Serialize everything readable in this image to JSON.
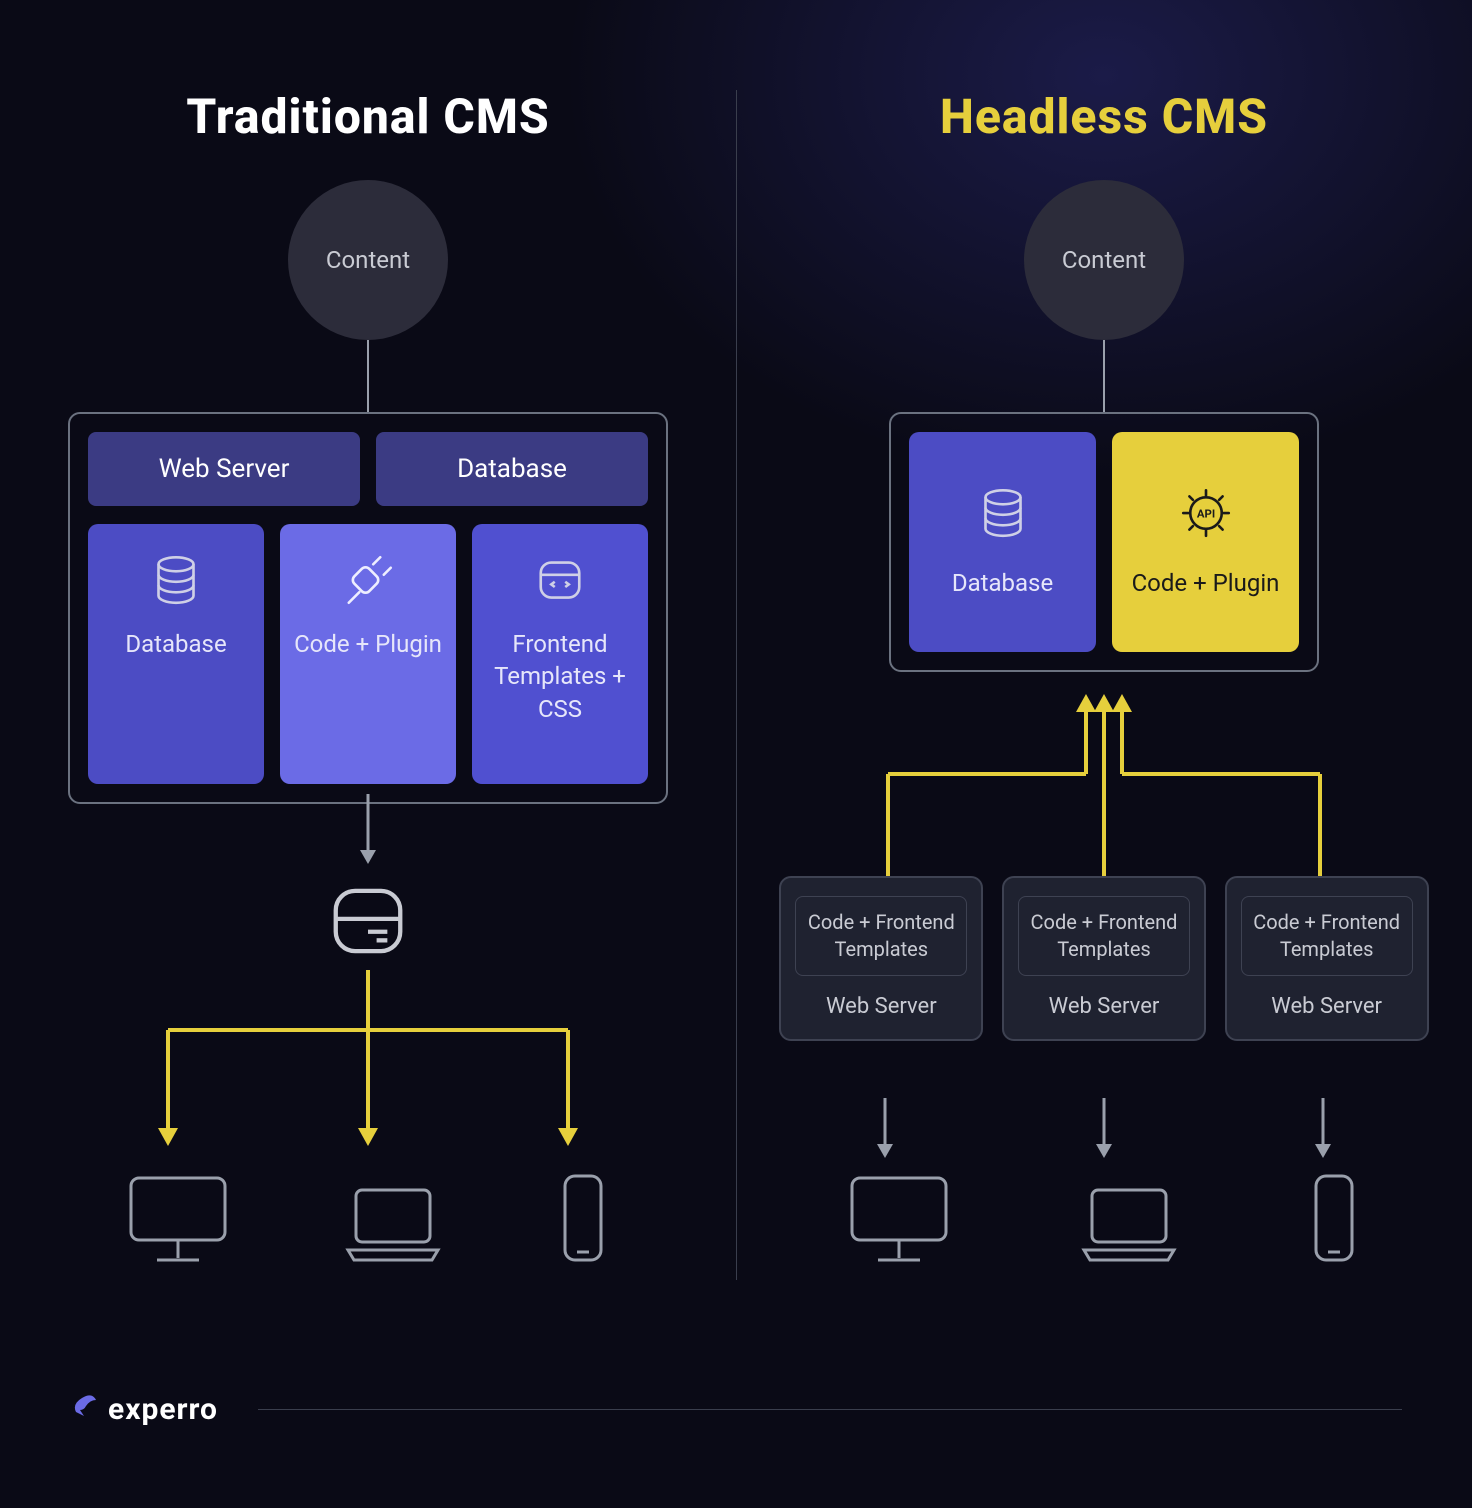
{
  "titles": {
    "left": "Traditional CMS",
    "right": "Headless CMS"
  },
  "shared": {
    "content_label": "Content",
    "database_label": "Database",
    "web_server_label": "Web Server"
  },
  "traditional": {
    "top_boxes": {
      "web_server": "Web Server",
      "database": "Database"
    },
    "cards": {
      "database": "Database",
      "code_plugin": "Code + Plugin",
      "frontend": "Frontend Templates + CSS"
    },
    "devices": [
      "desktop",
      "laptop",
      "mobile"
    ]
  },
  "headless": {
    "cards": {
      "database": "Database",
      "api_box": "Code + Plugin",
      "api_icon_label": "API"
    },
    "servers": [
      {
        "templates": "Code + Frontend Templates",
        "label": "Web Server"
      },
      {
        "templates": "Code + Frontend Templates",
        "label": "Web Server"
      },
      {
        "templates": "Code + Frontend Templates",
        "label": "Web Server"
      }
    ],
    "devices": [
      "desktop",
      "laptop",
      "mobile"
    ]
  },
  "footer": {
    "brand": "experro"
  },
  "colors": {
    "yellow": "#e6cf3c",
    "indigo": "#4c4cc4",
    "panel_border": "#6b7280"
  }
}
